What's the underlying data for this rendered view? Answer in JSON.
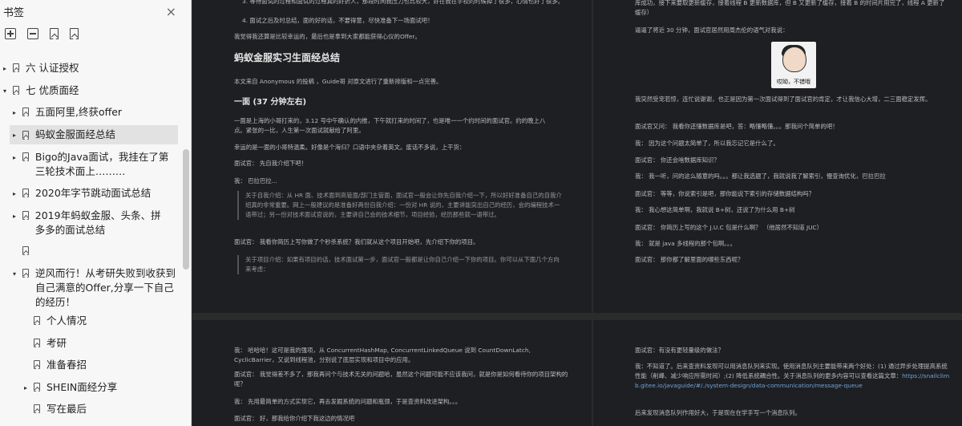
{
  "sidebar": {
    "title": "书签",
    "close_icon": "×",
    "items": [
      {
        "label": "六 认证授权",
        "arrow": "▸"
      },
      {
        "label": "七 优质面经",
        "arrow": "▾"
      },
      {
        "label": "五面阿里,终获offer",
        "arrow": "▸"
      },
      {
        "label": "蚂蚁金服面经总结",
        "arrow": "▸"
      },
      {
        "label": "Bigo的Java面试，我挂在了第三轮技术面上………",
        "arrow": "▸"
      },
      {
        "label": "2020年字节跳动面试总结",
        "arrow": "▸"
      },
      {
        "label": "2019年蚂蚁金服、头条、拼多多的面试总结",
        "arrow": "▸"
      },
      {
        "label": "",
        "arrow": ""
      },
      {
        "label": "逆风而行！从考研失败到收获到自己满意的Offer,分享一下自己的经历！",
        "arrow": "▾"
      },
      {
        "label": "个人情况",
        "arrow": ""
      },
      {
        "label": "考研",
        "arrow": ""
      },
      {
        "label": "准备春招",
        "arrow": ""
      },
      {
        "label": "SHEIN面经分享",
        "arrow": "▸"
      },
      {
        "label": "写在最后",
        "arrow": ""
      }
    ]
  },
  "page1": {
    "l1": "3.  等待面试的过程和面试的过程真的好折人，那段时间我压力也比较大，好在我在学校的时候掉了很多，心情也好了很多。",
    "l2": "4.  面试之后及时总结，面的好的话，不要得意，尽快准备下一场面试吧！",
    "l3": "我觉得我还算是比较幸运的，最后也是拿到大家都能获得心仪的Offer。",
    "heading": "蚂蚁金服实习生面经总结",
    "source": "本文来自 Anonymous 的投稿 ，Guide哥 对原文进行了重新排版和一点完善。",
    "sub": "一面 (37 分钟左右)",
    "p1": "一面是上海的小哥打来的，3.12 号中午确认的内推，下午就打来的时间了，也是唯一一个约时间的面试官。约的晚上八点。紧张的一比，人生第一次面试就献给了阿里。",
    "p2": "幸运的是一面的小哥特温柔。好像是个海归？口语中夹杂着英文。废话不多说，上干货：",
    "q1": "面试官：  先自我介绍下吧！",
    "a1": "我：  巴拉巴拉...",
    "quote1": "关于自我介绍：从 HR 面、技术面到高管面/部门主管面，面试官一般会让你先自我介绍一下，所以好好准备自己的自我介绍真的非常重要。网上一般建议的是准备好两份自我介绍：一份对 HR 说的，主要讲能突出自己的经历，会的编程技术一语带过；另一份对技术面试官说的，主要讲自己会的技术细节，项目经验，经历那些就一语带过。",
    "q2": "面试官：  我看你简历上写你做了个秒杀系统？我们就从这个项目开始吧，先介绍下你的项目。",
    "quote2": "关于项目介绍：如果有项目的话，技术面试第一步，面试官一般都是让你自己介绍一下你的项目。你可以从下面几个方向来考虑："
  },
  "page2": {
    "top": "库成功，接下来要取更新缓存，接着线程 B 更新数据库，但 B 又更新了缓存，接着 B 的时间片用完了，线程 A 更新了缓存）",
    "wait": "逼逼了将近 30 分钟，面试官居然用周杰伦的语气对我说：",
    "meme_caption": "哎呦，不错哦",
    "reply": "我突然受宠若惊，连忙说谢谢，也正是因为第一次面试得到了面试官的肯定，才让我信心大增，二三面稳定发挥。",
    "q1": "面试官又问：  我看你还懂数据库是吧，答：略懂略懂。。。那我问个简单的吧！",
    "a1": "我：  因为这个问题太简单了，所以我忘记它是什么了。",
    "q2": "面试官：  你还会啥数据库知识？",
    "a2": "我：  我一听，问的这么随意的吗。。。都让我选题了，我就说我了解索引，慢查询优化，巴拉巴拉",
    "q3": "面试官：  等等，你说索引是吧，那你能说下索引的存储数据结构吗？",
    "a3": "我：  我心想这简单啊，我就说 B+树，还说了为什么用 B+树",
    "q4": "面试官：  你简历上写的这个 J.U.C 包是什么啊？ （他居然不知道 JUC）",
    "a4": "我：  就是 java 多线程的那个包啊。。。",
    "q5": "面试官：  那你都了解里面的哪些东西呢？"
  },
  "page3": {
    "a1": "我：  哈哈哈！这可是我的强项，从 ConcurrentHashMap, ConcurrentLinkedQueue 说到 CountDownLatch, CyclicBarrier，又说到线程池，分别说了底层实现和项目中的应用。",
    "q1": "面试官：  我觉得差不多了，那我再问个与技术无关的问题哈，虽然这个问题可能不应该我问，就是你是如何看待你的项目架构的呢？",
    "a2": "我：  先用最简单的方式实现它，再去发掘系统的问题和瓶颈，于是查资料改进架构。。。",
    "q2": "面试官：  好，那我给你介绍下我这边的情况吧"
  },
  "page4": {
    "q1": "面试官：有没有更轻量级的做法？",
    "a1": "我：不知道了。后来查资料发现可以用消息队列来实现。使用消息队列主要能带来两个好处：(1) 通过异步处理提高系统性能（削峰、减少响应所需时间）;(2) 降低系统耦合性。关于消息队列的更多内容可以查看这篇文章：",
    "link": "https://snailclimb.gitee.io/javaguide/#/./system-design/data-communication/message-queue",
    "a2": "后来发现消息队列作用好大，于是现在在学手写一个消息队列。"
  }
}
